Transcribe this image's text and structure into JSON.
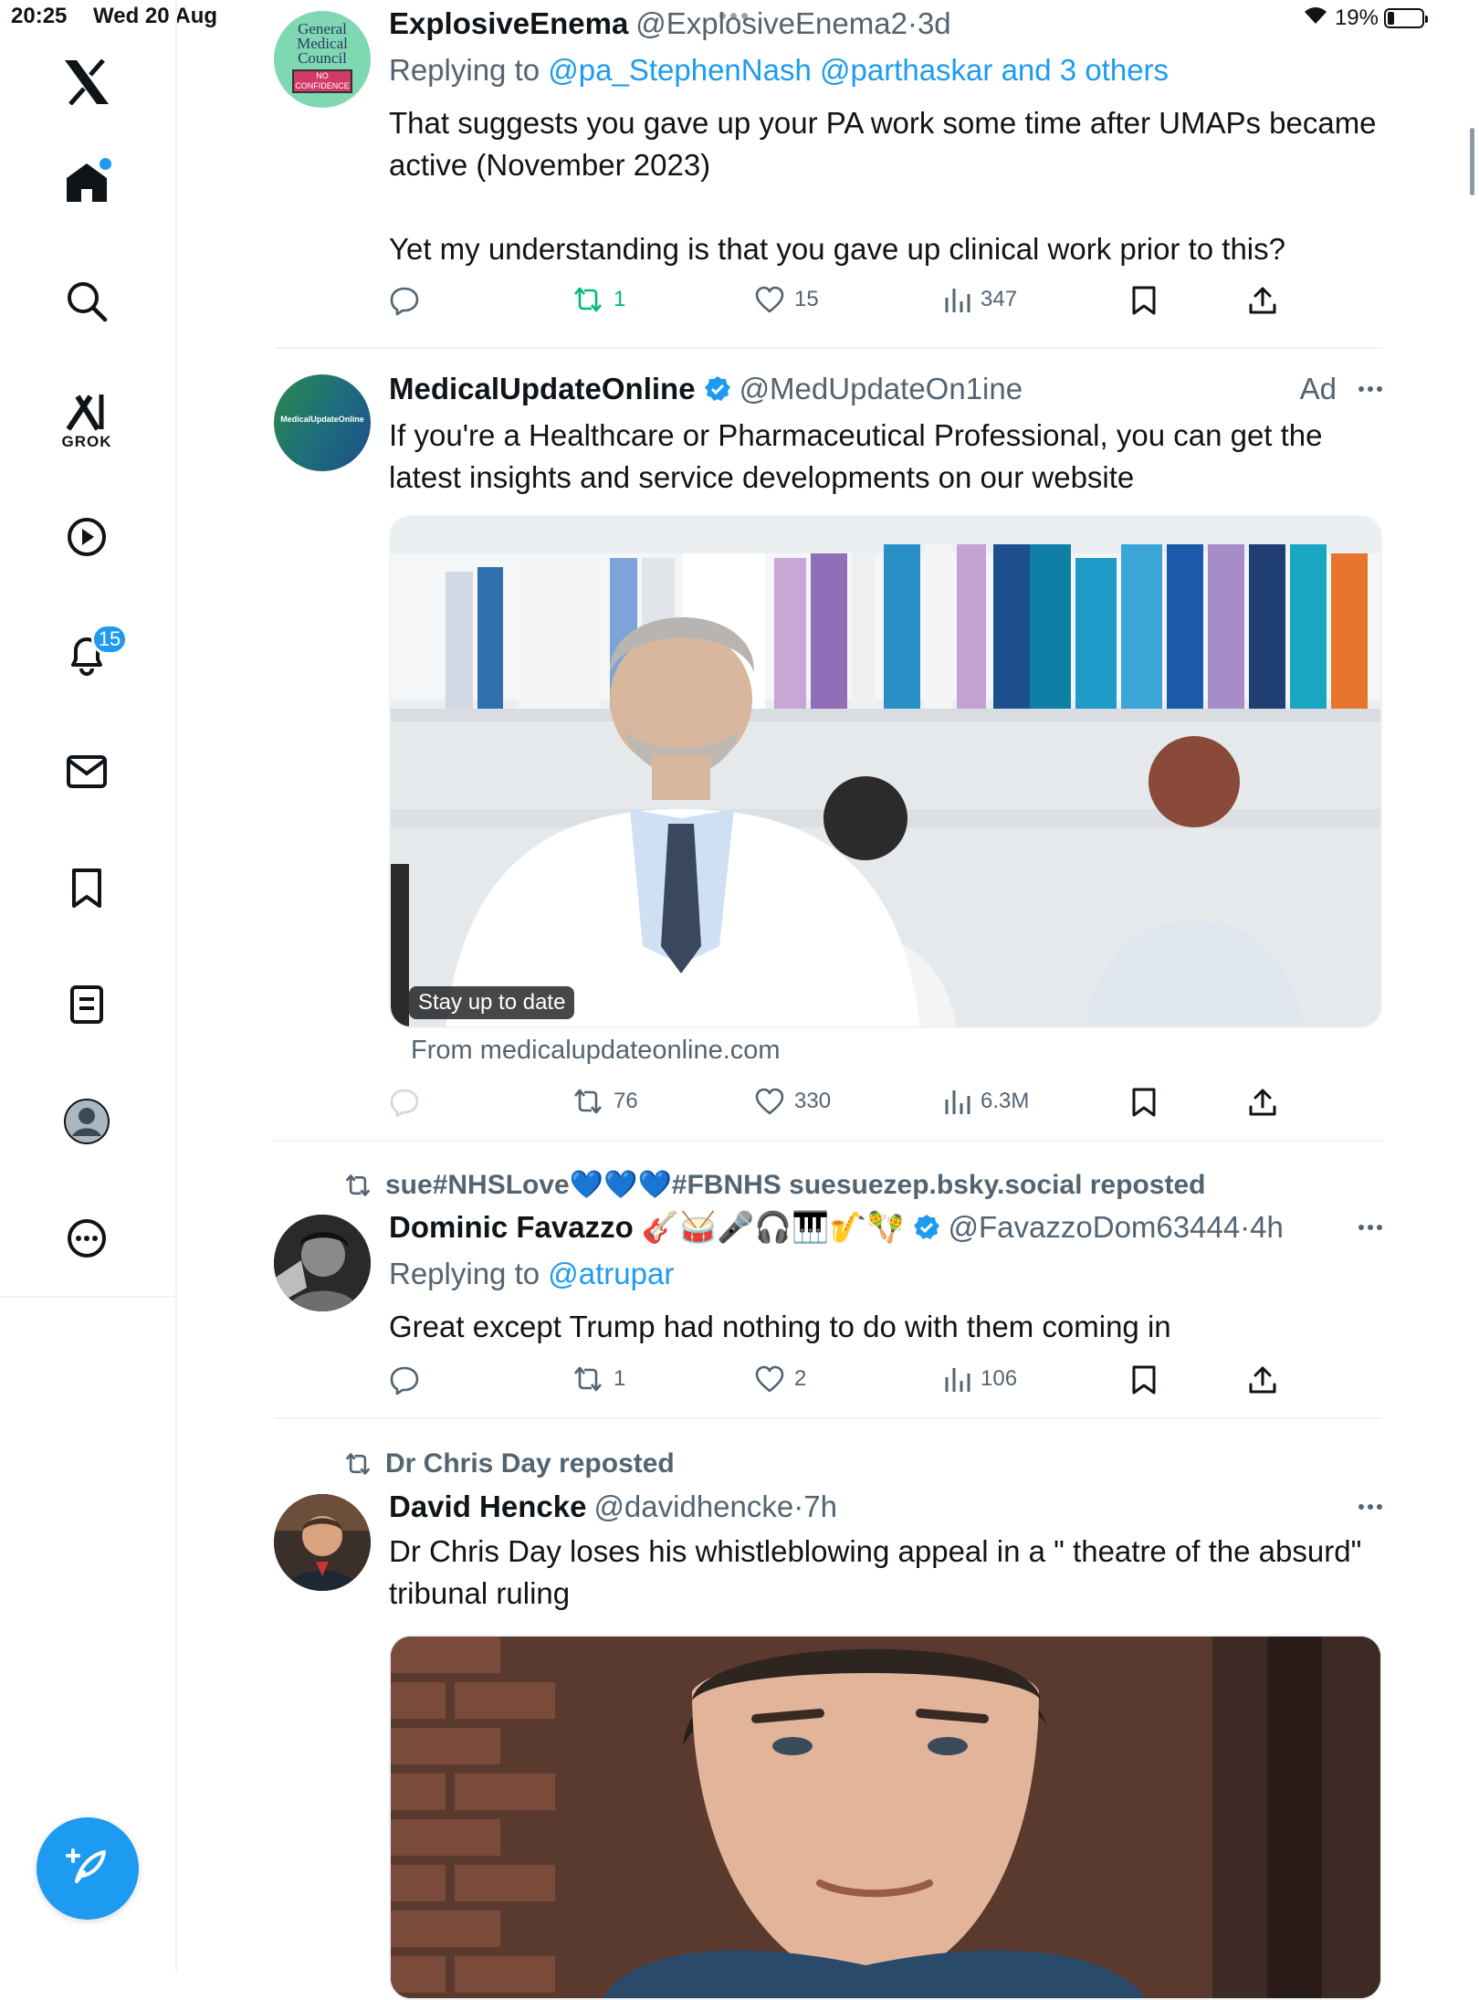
{
  "status_bar": {
    "time": "20:25",
    "date": "Wed 20 Aug",
    "battery": "19%",
    "battery_level": 0.19
  },
  "sidebar": {
    "grok_label": "GROK",
    "notification_count": "15"
  },
  "tweets": [
    {
      "name": "ExplosiveEnema",
      "handle": "@ExplosiveEnema2",
      "sep": "·",
      "time": "3d",
      "replying_prefix": "Replying to",
      "replying_to": "@pa_StephenNash @parthaskar and 3 others",
      "text1": "That suggests you gave up your PA work some time after UMAPs became active (November 2023)",
      "text2": "Yet my understanding is that you gave up clinical work prior to this?",
      "avatar_text": [
        "General",
        "Medical",
        "Council"
      ],
      "avatar_stamp": "NO CONFIDENCE",
      "reposts": "1",
      "likes": "15",
      "views": "347"
    },
    {
      "name": "MedicalUpdateOnline",
      "handle": "@MedUpdateOn1ine",
      "ad_label": "Ad",
      "text": "If you're a Healthcare or Pharmaceutical Professional, you can get the latest insights and service developments on our website",
      "avatar_text": "MedicalUpdateOnline",
      "image_caption": "Stay up to date",
      "from": "From medicalupdateonline.com",
      "reposts": "76",
      "likes": "330",
      "views": "6.3M"
    },
    {
      "reposted_by": "sue#NHSLove💙💙💙#FBNHS suesuezep.bsky.social reposted",
      "name": "Dominic Favazzo 🎸🥁🎤🎧🎹🎷🪇",
      "handle": "@FavazzoDom63444",
      "sep": "·",
      "time": "4h",
      "replying_prefix": "Replying to",
      "replying_to": "@atrupar",
      "text": "Great except Trump had nothing to do with them coming in",
      "reposts": "1",
      "likes": "2",
      "views": "106"
    },
    {
      "reposted_by": "Dr Chris Day reposted",
      "name": "David Hencke",
      "handle": "@davidhencke",
      "sep": "·",
      "time": "7h",
      "text": "Dr Chris Day loses his whistleblowing appeal in a \" theatre of the absurd\" tribunal ruling"
    }
  ],
  "colors": {
    "accent": "#1d9bf0",
    "secondary_text": "#536471",
    "repost_green": "#00ba7c",
    "divider": "#eff3f4"
  },
  "icons": [
    "x-logo-icon",
    "home-icon",
    "search-icon",
    "grok-icon",
    "video-icon",
    "bell-icon",
    "mail-icon",
    "bookmark-icon",
    "lists-icon",
    "profile-icon",
    "more-icon",
    "compose-icon",
    "reply-icon",
    "repost-icon",
    "like-icon",
    "views-icon",
    "share-icon",
    "verified-icon"
  ]
}
